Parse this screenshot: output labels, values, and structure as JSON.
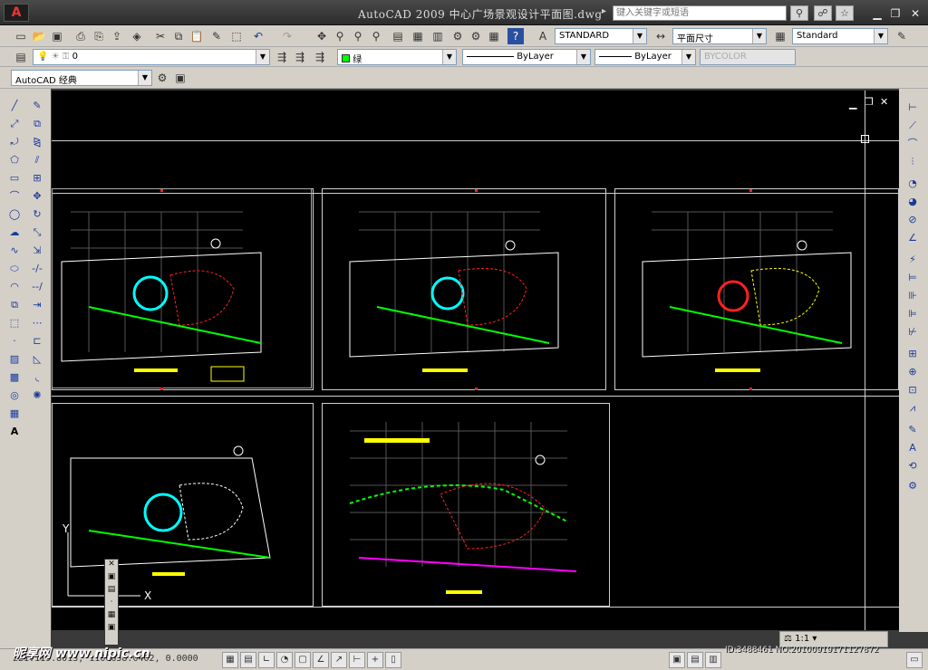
{
  "titlebar": {
    "title": "AutoCAD 2009 中心广场景观设计平面图.dwg",
    "help_placeholder": "键入关键字或短语"
  },
  "toolbar": {
    "text_style": "STANDARD",
    "dim_style": "平面尺寸",
    "table_style": "Standard",
    "layer": "0",
    "color": "绿",
    "linetype": "ByLayer",
    "lineweight": "ByLayer",
    "plotstyle": "BYCOLOR",
    "workspace": "AutoCAD 经典"
  },
  "status": {
    "coordinates": "221.119.8013, 1100658.0402, 0.0000",
    "annotation_scale": "1:1"
  },
  "watermark": {
    "brand": "昵享网 www.nipic.cn",
    "id": "ID:3488461 NO:20100919171127872"
  },
  "colors": {
    "background": "#000000",
    "titlebar": "#2c2c2c",
    "toolbar": "#d4d0c8",
    "accent_yellow": "#ffff00",
    "accent_cyan": "#00ffff",
    "accent_red": "#ff2222",
    "accent_green": "#00ff00",
    "accent_magenta": "#ff00ff"
  },
  "icons": {
    "app": "autocad-logo-icon",
    "search": "search-icon",
    "close": "close-icon"
  }
}
